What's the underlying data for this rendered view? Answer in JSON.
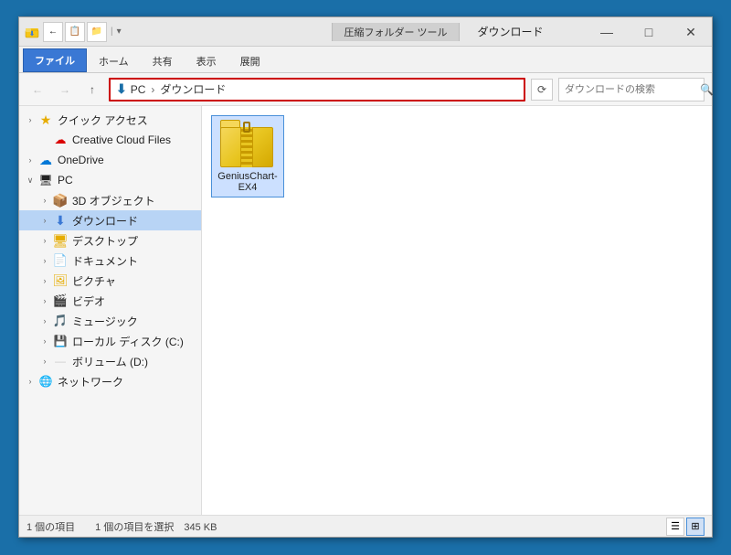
{
  "window": {
    "title": "ダウンロード",
    "zip_tool": "圧縮フォルダー ツール"
  },
  "title_bar": {
    "controls": {
      "minimize": "—",
      "maximize": "□",
      "close": "✕"
    }
  },
  "ribbon": {
    "tabs": [
      {
        "label": "ファイル",
        "active": true
      },
      {
        "label": "ホーム",
        "active": false
      },
      {
        "label": "共有",
        "active": false
      },
      {
        "label": "表示",
        "active": false
      },
      {
        "label": "展開",
        "active": false
      }
    ]
  },
  "address_bar": {
    "path_icon": "⬇",
    "parts": [
      "PC",
      "ダウンロード"
    ],
    "separator": "›",
    "search_placeholder": "ダウンロードの検索"
  },
  "sidebar": {
    "items": [
      {
        "id": "quick-access",
        "label": "クイック アクセス",
        "indent": 0,
        "toggle": "›",
        "icon": "★",
        "icon_class": "icon-folder"
      },
      {
        "id": "cc-files",
        "label": "Creative Cloud Files",
        "indent": 1,
        "toggle": "",
        "icon": "☁",
        "icon_class": "icon-cc"
      },
      {
        "id": "onedrive",
        "label": "OneDrive",
        "indent": 0,
        "toggle": "›",
        "icon": "☁",
        "icon_class": "icon-cloud"
      },
      {
        "id": "pc",
        "label": "PC",
        "indent": 0,
        "toggle": "∨",
        "icon": "💻",
        "icon_class": "icon-pc"
      },
      {
        "id": "3d",
        "label": "3D オブジェクト",
        "indent": 1,
        "toggle": "›",
        "icon": "📦",
        "icon_class": "icon-3d"
      },
      {
        "id": "downloads",
        "label": "ダウンロード",
        "indent": 1,
        "toggle": "›",
        "icon": "⬇",
        "icon_class": "icon-folder-dl",
        "selected": true
      },
      {
        "id": "desktop",
        "label": "デスクトップ",
        "indent": 1,
        "toggle": "›",
        "icon": "🖥",
        "icon_class": "icon-desktop"
      },
      {
        "id": "documents",
        "label": "ドキュメント",
        "indent": 1,
        "toggle": "›",
        "icon": "📄",
        "icon_class": "icon-doc"
      },
      {
        "id": "pictures",
        "label": "ピクチャ",
        "indent": 1,
        "toggle": "›",
        "icon": "🖼",
        "icon_class": "icon-pic"
      },
      {
        "id": "videos",
        "label": "ビデオ",
        "indent": 1,
        "toggle": "›",
        "icon": "🎬",
        "icon_class": "icon-video"
      },
      {
        "id": "music",
        "label": "ミュージック",
        "indent": 1,
        "toggle": "›",
        "icon": "🎵",
        "icon_class": "icon-music"
      },
      {
        "id": "local-c",
        "label": "ローカル ディスク (C:)",
        "indent": 1,
        "toggle": "›",
        "icon": "💾",
        "icon_class": "icon-drive"
      },
      {
        "id": "volume-d",
        "label": "ボリューム (D:)",
        "indent": 1,
        "toggle": "›",
        "icon": "💿",
        "icon_class": "icon-drive"
      },
      {
        "id": "network",
        "label": "ネットワーク",
        "indent": 0,
        "toggle": "›",
        "icon": "🌐",
        "icon_class": "icon-network"
      }
    ]
  },
  "files": [
    {
      "name": "GeniusChart-EX4",
      "type": "zip-folder",
      "selected": true
    }
  ],
  "status_bar": {
    "left": "1 個の項目　　1 個の項目を選択　345 KB",
    "view_icons": [
      "☰",
      "⊞"
    ]
  }
}
